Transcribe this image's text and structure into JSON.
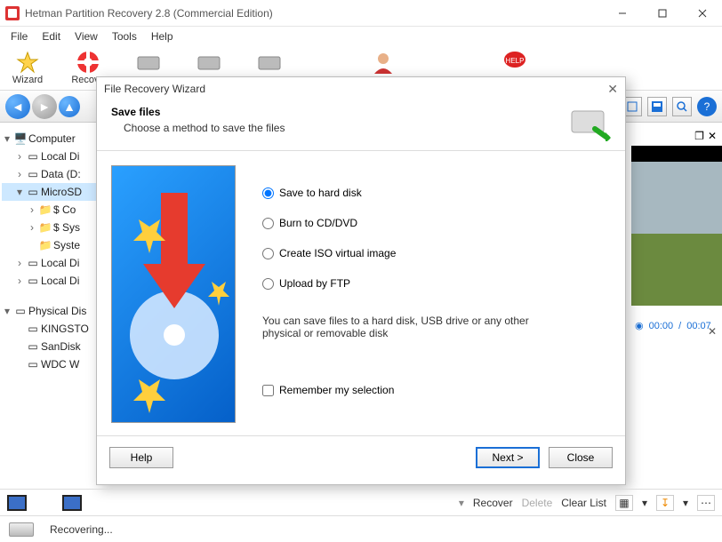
{
  "window": {
    "title": "Hetman Partition Recovery 2.8 (Commercial Edition)"
  },
  "menu": {
    "file": "File",
    "edit": "Edit",
    "view": "View",
    "tools": "Tools",
    "help": "Help"
  },
  "toolbar": {
    "wizard": "Wizard",
    "recover": "Recove"
  },
  "tree": {
    "computer": "Computer",
    "local1": "Local Di",
    "data": "Data (D:",
    "microsd": "MicroSD",
    "scor": "$ Co",
    "ssys": "$ Sys",
    "syst": "Syste",
    "local2": "Local Di",
    "local3": "Local Di",
    "physical": "Physical Dis",
    "kingston": "KINGSTO",
    "sandisk": "SanDisk",
    "wdc": "WDC W"
  },
  "right": {
    "time_cur": "00:00",
    "time_sep": "/",
    "time_tot": "00:07"
  },
  "wizard": {
    "dialog_title": "File Recovery Wizard",
    "heading": "Save files",
    "sub": "Choose a method to save the files",
    "opt1": "Save to hard disk",
    "opt2": "Burn to CD/DVD",
    "opt3": "Create ISO virtual image",
    "opt4": "Upload by FTP",
    "desc": "You can save files to a hard disk, USB drive or any other physical or removable disk",
    "remember": "Remember my selection",
    "help": "Help",
    "next": "Next  >",
    "close": "Close"
  },
  "bottom": {
    "recover": "Recover",
    "delete": "Delete",
    "clear": "Clear List"
  },
  "status": {
    "text": "Recovering..."
  }
}
